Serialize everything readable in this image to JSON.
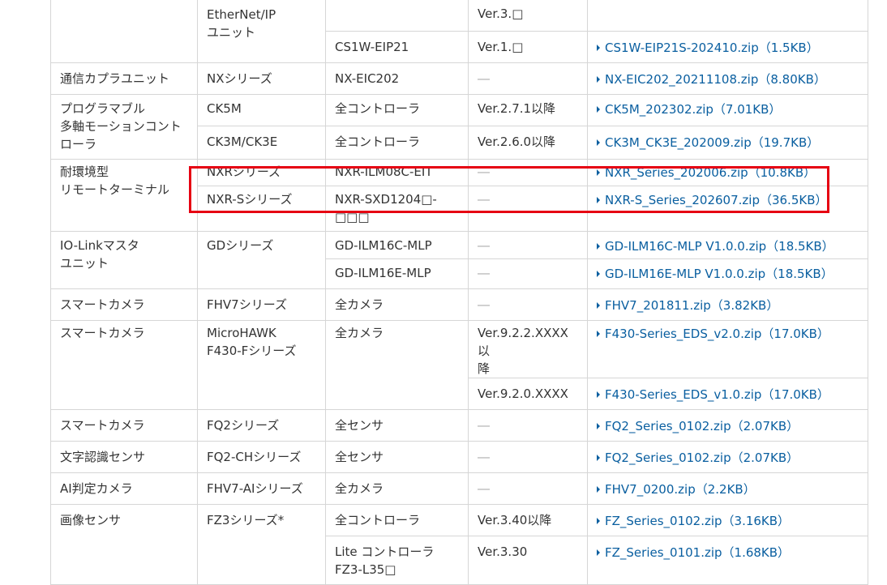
{
  "rows": {
    "eip": {
      "series": "EtherNet/IP\nユニット",
      "model": "CS1W-EIP21",
      "ver_top": "Ver.3.□",
      "ver": "Ver.1.□",
      "file": "CS1W-EIP21S-202410.zip（1.5KB）"
    },
    "coupler": {
      "category": "通信カプラユニット",
      "series": "NXシリーズ",
      "model": "NX-EIC202",
      "ver": "―",
      "file": "NX-EIC202_20211108.zip（8.80KB）"
    },
    "motion": {
      "category": "プログラマブル\n多軸モーションコント\nローラ",
      "series1": "CK5M",
      "model1": "全コントローラ",
      "ver1": "Ver.2.7.1以降",
      "file1": "CK5M_202302.zip（7.01KB）",
      "series2": "CK3M/CK3E",
      "model2": "全コントローラ",
      "ver2": "Ver.2.6.0以降",
      "file2": "CK3M_CK3E_202009.zip（19.7KB）"
    },
    "remote": {
      "category": "耐環境型\nリモートターミナル",
      "series1": "NXRシリーズ",
      "model1": "NXR-ILM08C-EIT",
      "ver1": "―",
      "file1": "NXR_Series_202006.zip（10.8KB）",
      "series2": "NXR-Sシリーズ",
      "model2": "NXR-SXD1204□-\n□□□",
      "ver2": "―",
      "file2": "NXR-S_Series_202607.zip（36.5KB）"
    },
    "iolink": {
      "category": "IO-Linkマスタ\nユニット",
      "series": "GDシリーズ",
      "model1": "GD-ILM16C-MLP",
      "ver1": "―",
      "file1": "GD-ILM16C-MLP V1.0.0.zip（18.5KB）",
      "model2": "GD-ILM16E-MLP",
      "ver2": "―",
      "file2": "GD-ILM16E-MLP V1.0.0.zip（18.5KB）"
    },
    "camera1": {
      "category": "スマートカメラ",
      "series": "FHV7シリーズ",
      "model": "全カメラ",
      "ver": "―",
      "file": "FHV7_201811.zip（3.82KB）"
    },
    "camera2": {
      "category": "スマートカメラ",
      "series": "MicroHAWK\nF430-Fシリーズ",
      "model": "全カメラ",
      "ver1": "Ver.9.2.2.XXXX以\n降",
      "file1": "F430-Series_EDS_v2.0.zip（17.0KB）",
      "ver2": "Ver.9.2.0.XXXX",
      "file2": "F430-Series_EDS_v1.0.zip（17.0KB）"
    },
    "camera3": {
      "category": "スマートカメラ",
      "series": "FQ2シリーズ",
      "model": "全センサ",
      "ver": "―",
      "file": "FQ2_Series_0102.zip（2.07KB）"
    },
    "ocr": {
      "category": "文字認識センサ",
      "series": "FQ2-CHシリーズ",
      "model": "全センサ",
      "ver": "―",
      "file": "FQ2_Series_0102.zip（2.07KB）"
    },
    "ai": {
      "category": "AI判定カメラ",
      "series": "FHV7-AIシリーズ",
      "model": "全カメラ",
      "ver": "―",
      "file": "FHV7_0200.zip（2.2KB）"
    },
    "vision": {
      "category": "画像センサ",
      "series": "FZ3シリーズ*",
      "model1": "全コントローラ",
      "ver1": "Ver.3.40以降",
      "file1": "FZ_Series_0102.zip（3.16KB）",
      "model2": "Lite コントローラ\nFZ3-L35□",
      "ver2": "Ver.3.30",
      "file2": "FZ_Series_0101.zip（1.68KB）"
    }
  },
  "highlight_color": "#e60012",
  "link_color": "#0a5fa0"
}
